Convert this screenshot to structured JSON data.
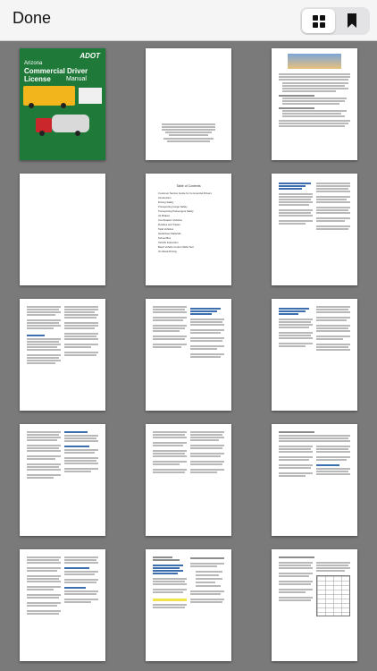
{
  "toolbar": {
    "done_label": "Done",
    "view_icons": [
      "grid-icon",
      "bookmark-icon"
    ]
  },
  "cover": {
    "agency": "ADOT",
    "state": "Arizona",
    "title": "Commercial Driver License",
    "subtitle": "Manual"
  },
  "toc": {
    "heading": "Table of Contents",
    "entries": [
      "Customer Service Guide for Commercial Drivers",
      "Introduction",
      "Driving Safely",
      "Transporting Cargo Safely",
      "Transporting Passengers Safely",
      "Air Brakes",
      "Combination Vehicles",
      "Doubles and Triples",
      "Tank Vehicles",
      "Hazardous Materials",
      "School Bus",
      "Vehicle Inspection",
      "Basic Vehicle Control Skills Test",
      "On-Road Driving"
    ]
  },
  "colors": {
    "toolbar_bg": "#f5f5f5",
    "grid_bg": "#7a7a7a",
    "cover_green": "#1f7a3a",
    "heading_blue": "#3d6fae"
  }
}
